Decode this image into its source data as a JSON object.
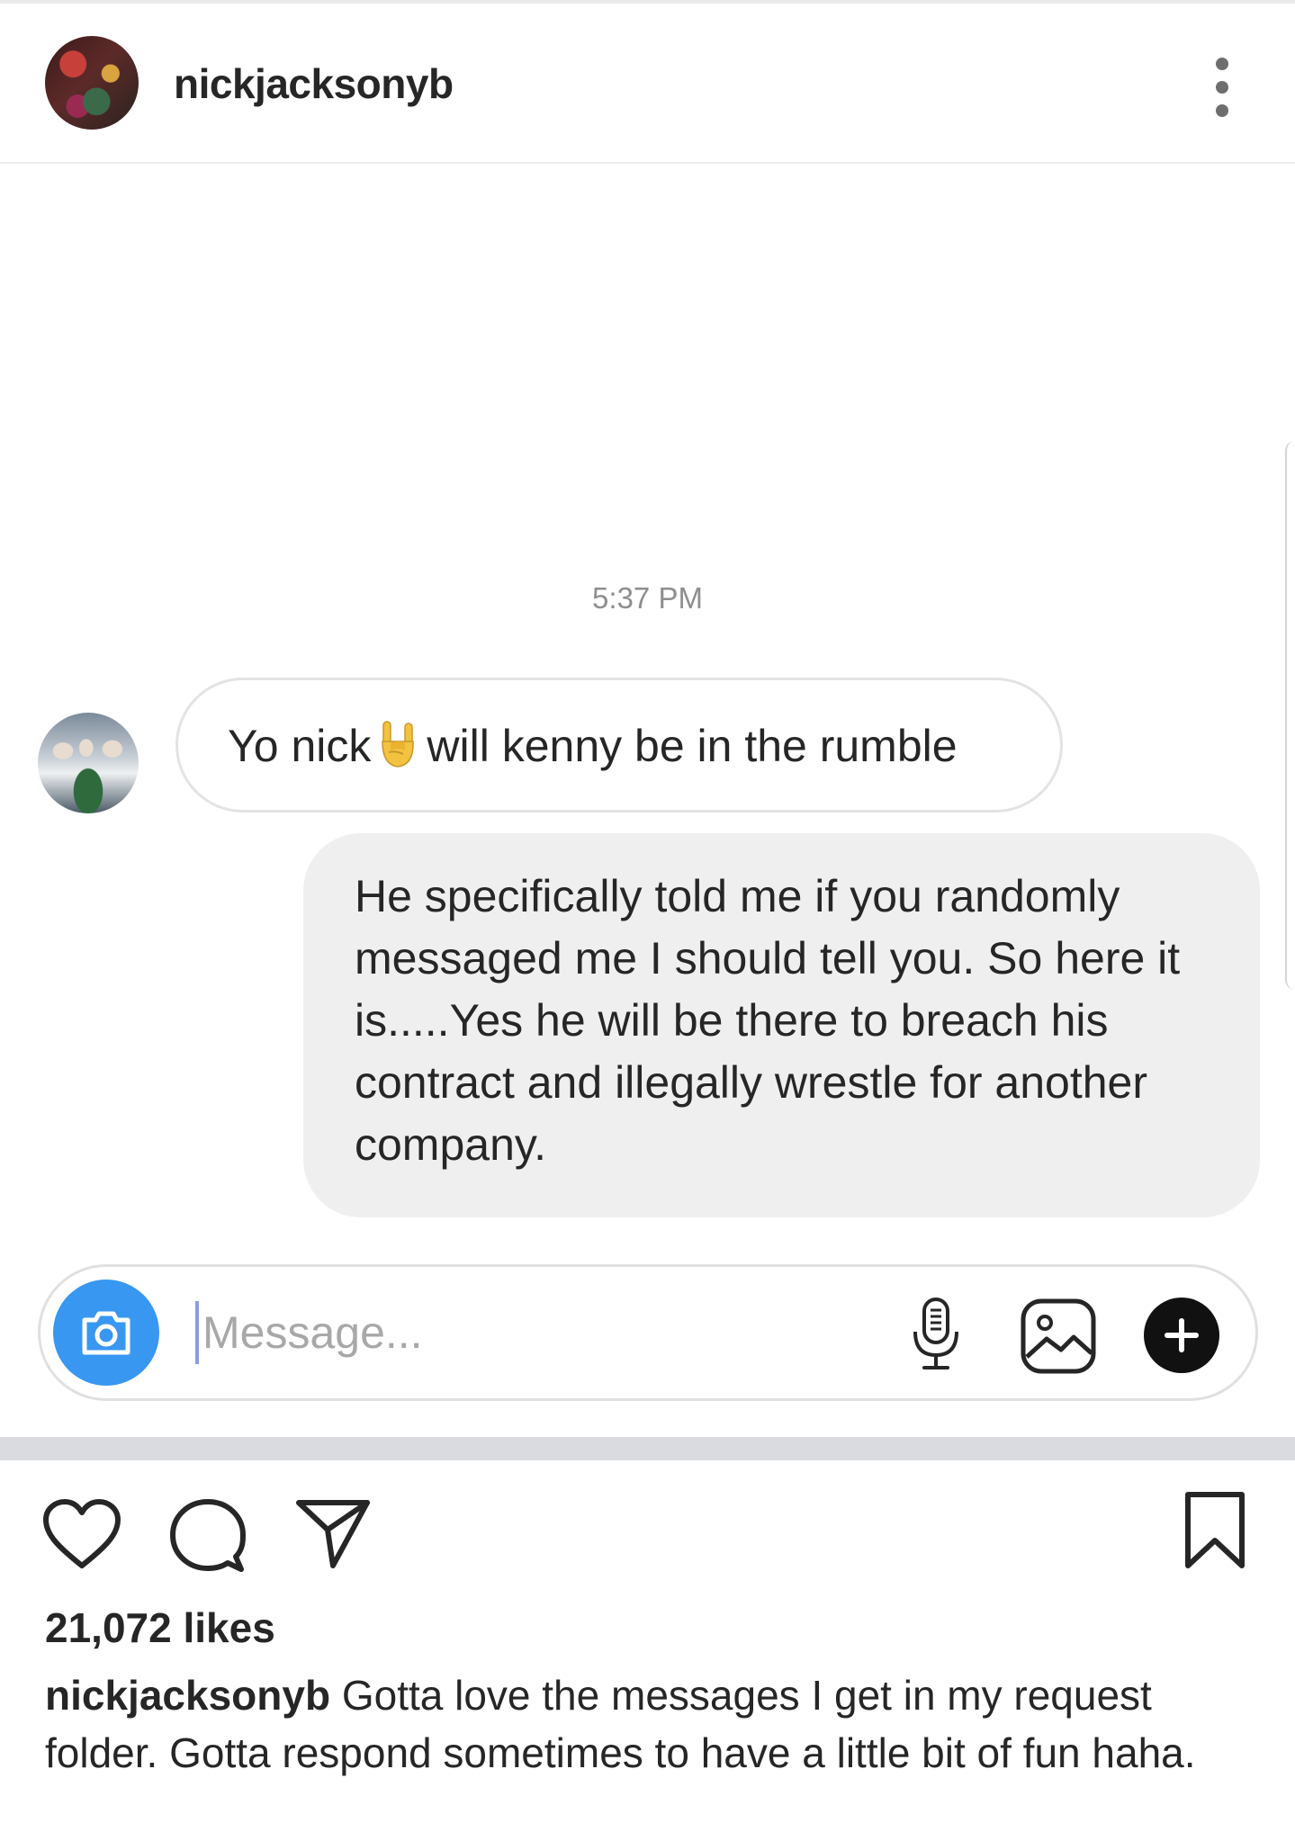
{
  "post": {
    "username": "nickjacksonyb"
  },
  "chat": {
    "timestamp": "5:37 PM",
    "incoming": {
      "before_emoji": "Yo nick",
      "emoji": "sign-of-the-horns",
      "after_emoji": "will kenny be in the rumble"
    },
    "outgoing": {
      "text": "He specifically told me if you randomly messaged me I should tell you. So here it is.....Yes he will be there to breach his contract and illegally wrestle for another company."
    },
    "composer": {
      "placeholder": "Message..."
    }
  },
  "icons": {
    "more": "more-vertical-icon",
    "camera": "camera-icon",
    "mic": "microphone-icon",
    "gallery": "gallery-icon",
    "plus": "plus-icon",
    "like": "heart-icon",
    "comment": "comment-icon",
    "share": "send-icon",
    "save": "bookmark-icon"
  },
  "colors": {
    "accent_blue": "#3897f0",
    "text": "#262626",
    "muted": "#8e8e8e",
    "bubble_gray": "#efefef"
  },
  "footer": {
    "likes": "21,072 likes",
    "caption_user": "nickjacksonyb",
    "caption_text": " Gotta love the messages I get in my request folder. Gotta respond sometimes to have a little bit of fun haha."
  }
}
